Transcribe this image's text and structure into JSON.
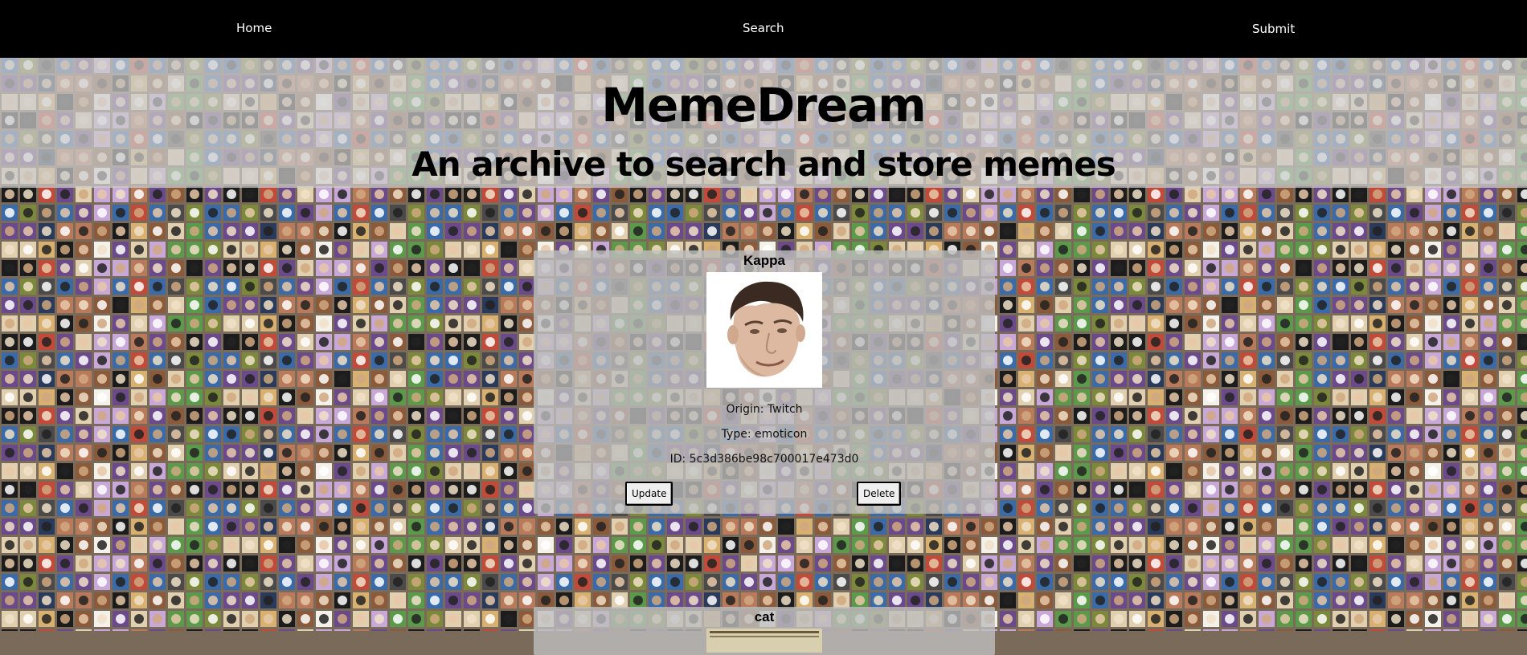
{
  "nav": {
    "home_label": "Home",
    "search_label": "Search",
    "submit_label": "Submit"
  },
  "header": {
    "title": "MemeDream",
    "subtitle": "An archive to search and store memes"
  },
  "memes": [
    {
      "name": "Kappa",
      "origin": "Origin: Twitch",
      "type": "Type: emoticon",
      "id": "ID: 5c3d386be98c700017e473d0",
      "update_label": "Update",
      "delete_label": "Delete"
    },
    {
      "name": "cat"
    }
  ],
  "colors": {
    "navbar": "#000000",
    "nav_text": "#ffffff",
    "header_band": "#cdcdcd",
    "card_bg": "#bebebe"
  }
}
